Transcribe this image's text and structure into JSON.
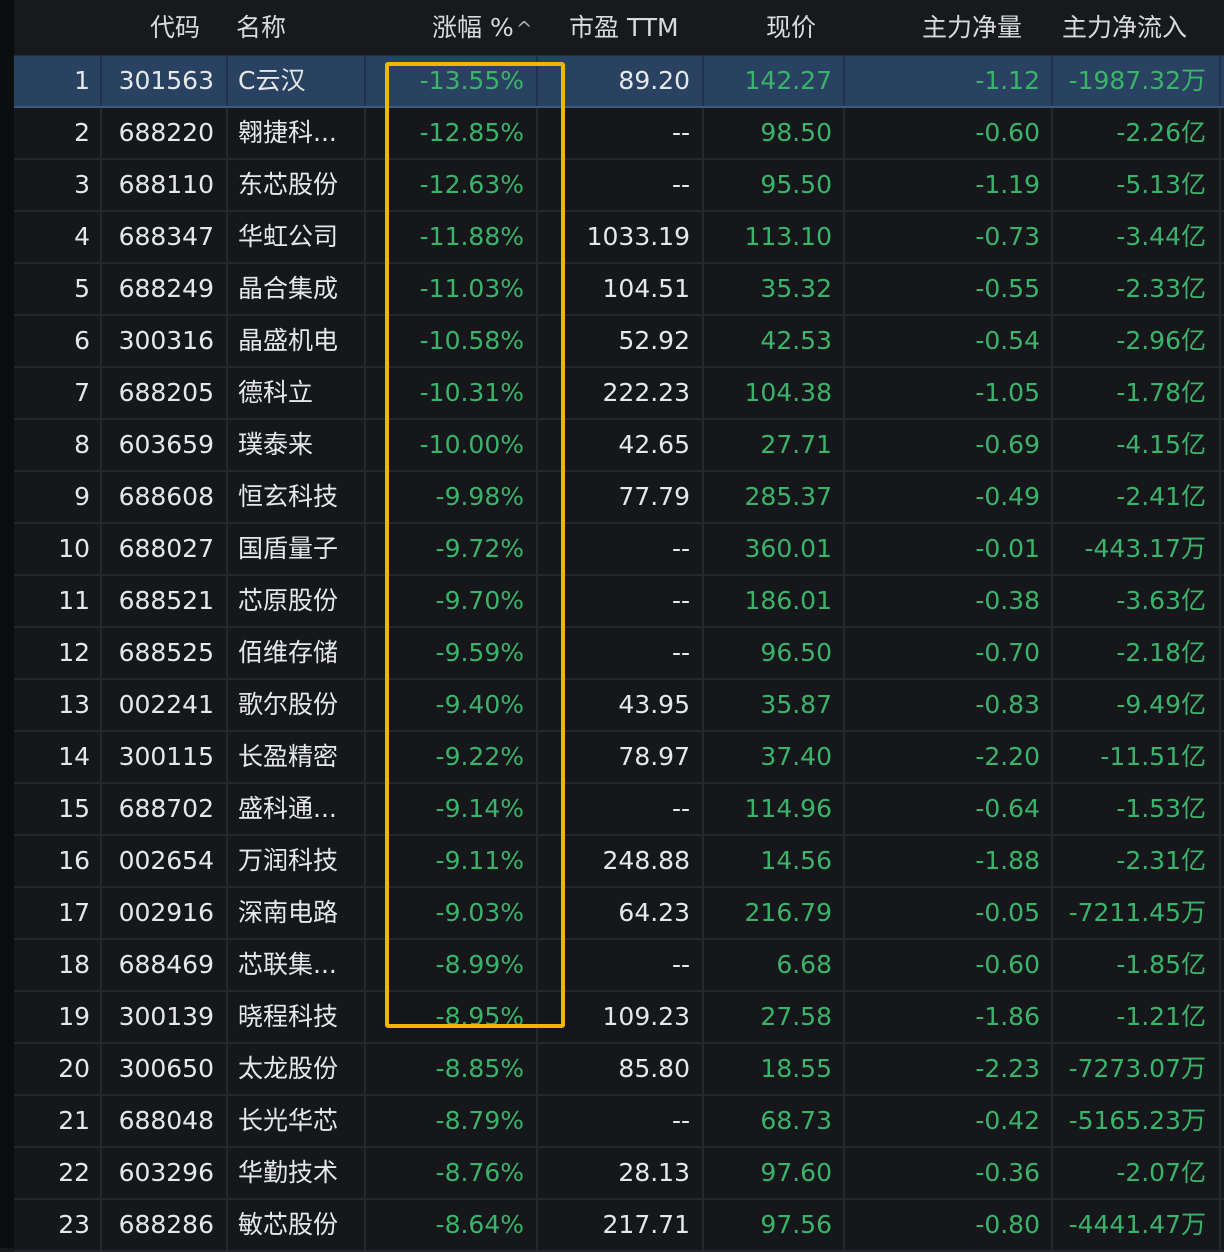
{
  "columns": {
    "code": "代码",
    "name": "名称",
    "change": "涨幅 %",
    "pe": "市盈 TTM",
    "price": "现价",
    "main_net": "主力净量",
    "main_flow": "主力净流入"
  },
  "sort_indicator": "^",
  "rows": [
    {
      "idx": "1",
      "code": "301563",
      "name": "C云汉",
      "change": "-13.55%",
      "pe": "89.20",
      "price": "142.27",
      "net": "-1.12",
      "flow": "-1987.32万"
    },
    {
      "idx": "2",
      "code": "688220",
      "name": "翱捷科...",
      "change": "-12.85%",
      "pe": "--",
      "price": "98.50",
      "net": "-0.60",
      "flow": "-2.26亿"
    },
    {
      "idx": "3",
      "code": "688110",
      "name": "东芯股份",
      "change": "-12.63%",
      "pe": "--",
      "price": "95.50",
      "net": "-1.19",
      "flow": "-5.13亿"
    },
    {
      "idx": "4",
      "code": "688347",
      "name": "华虹公司",
      "change": "-11.88%",
      "pe": "1033.19",
      "price": "113.10",
      "net": "-0.73",
      "flow": "-3.44亿"
    },
    {
      "idx": "5",
      "code": "688249",
      "name": "晶合集成",
      "change": "-11.03%",
      "pe": "104.51",
      "price": "35.32",
      "net": "-0.55",
      "flow": "-2.33亿"
    },
    {
      "idx": "6",
      "code": "300316",
      "name": "晶盛机电",
      "change": "-10.58%",
      "pe": "52.92",
      "price": "42.53",
      "net": "-0.54",
      "flow": "-2.96亿"
    },
    {
      "idx": "7",
      "code": "688205",
      "name": "德科立",
      "change": "-10.31%",
      "pe": "222.23",
      "price": "104.38",
      "net": "-1.05",
      "flow": "-1.78亿"
    },
    {
      "idx": "8",
      "code": "603659",
      "name": "璞泰来",
      "change": "-10.00%",
      "pe": "42.65",
      "price": "27.71",
      "net": "-0.69",
      "flow": "-4.15亿"
    },
    {
      "idx": "9",
      "code": "688608",
      "name": "恒玄科技",
      "change": "-9.98%",
      "pe": "77.79",
      "price": "285.37",
      "net": "-0.49",
      "flow": "-2.41亿"
    },
    {
      "idx": "10",
      "code": "688027",
      "name": "国盾量子",
      "change": "-9.72%",
      "pe": "--",
      "price": "360.01",
      "net": "-0.01",
      "flow": "-443.17万"
    },
    {
      "idx": "11",
      "code": "688521",
      "name": "芯原股份",
      "change": "-9.70%",
      "pe": "--",
      "price": "186.01",
      "net": "-0.38",
      "flow": "-3.63亿"
    },
    {
      "idx": "12",
      "code": "688525",
      "name": "佰维存储",
      "change": "-9.59%",
      "pe": "--",
      "price": "96.50",
      "net": "-0.70",
      "flow": "-2.18亿"
    },
    {
      "idx": "13",
      "code": "002241",
      "name": "歌尔股份",
      "change": "-9.40%",
      "pe": "43.95",
      "price": "35.87",
      "net": "-0.83",
      "flow": "-9.49亿"
    },
    {
      "idx": "14",
      "code": "300115",
      "name": "长盈精密",
      "change": "-9.22%",
      "pe": "78.97",
      "price": "37.40",
      "net": "-2.20",
      "flow": "-11.51亿"
    },
    {
      "idx": "15",
      "code": "688702",
      "name": "盛科通...",
      "change": "-9.14%",
      "pe": "--",
      "price": "114.96",
      "net": "-0.64",
      "flow": "-1.53亿"
    },
    {
      "idx": "16",
      "code": "002654",
      "name": "万润科技",
      "change": "-9.11%",
      "pe": "248.88",
      "price": "14.56",
      "net": "-1.88",
      "flow": "-2.31亿"
    },
    {
      "idx": "17",
      "code": "002916",
      "name": "深南电路",
      "change": "-9.03%",
      "pe": "64.23",
      "price": "216.79",
      "net": "-0.05",
      "flow": "-7211.45万"
    },
    {
      "idx": "18",
      "code": "688469",
      "name": "芯联集...",
      "change": "-8.99%",
      "pe": "--",
      "price": "6.68",
      "net": "-0.60",
      "flow": "-1.85亿"
    },
    {
      "idx": "19",
      "code": "300139",
      "name": "晓程科技",
      "change": "-8.95%",
      "pe": "109.23",
      "price": "27.58",
      "net": "-1.86",
      "flow": "-1.21亿"
    },
    {
      "idx": "20",
      "code": "300650",
      "name": "太龙股份",
      "change": "-8.85%",
      "pe": "85.80",
      "price": "18.55",
      "net": "-2.23",
      "flow": "-7273.07万"
    },
    {
      "idx": "21",
      "code": "688048",
      "name": "长光华芯",
      "change": "-8.79%",
      "pe": "--",
      "price": "68.73",
      "net": "-0.42",
      "flow": "-5165.23万"
    },
    {
      "idx": "22",
      "code": "603296",
      "name": "华勤技术",
      "change": "-8.76%",
      "pe": "28.13",
      "price": "97.60",
      "net": "-0.36",
      "flow": "-2.07亿"
    },
    {
      "idx": "23",
      "code": "688286",
      "name": "敏芯股份",
      "change": "-8.64%",
      "pe": "217.71",
      "price": "97.56",
      "net": "-0.80",
      "flow": "-4441.47万"
    }
  ],
  "selected_row": 0,
  "colors": {
    "background": "#15171a",
    "selected_row": "#2a4261",
    "down_green": "#3bb36a",
    "highlight_box": "#f4b400"
  }
}
